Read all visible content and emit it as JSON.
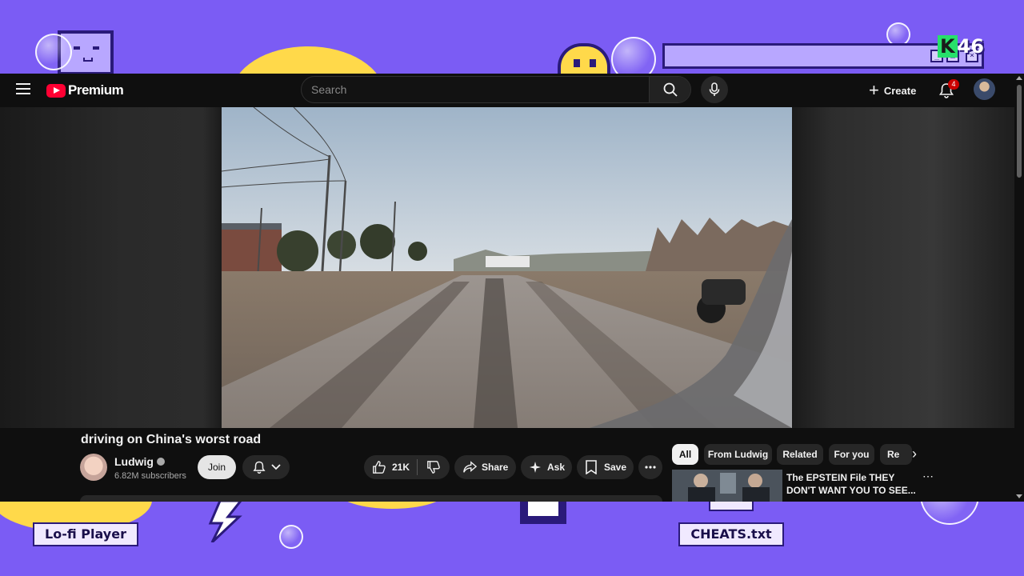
{
  "desktop": {
    "labels": {
      "lofi": "Lo-fi Player",
      "cheats": "CHEATS.txt"
    },
    "badge": {
      "k": "K",
      "num": "46"
    },
    "colors": {
      "background": "#7b5cf4",
      "accent_yellow": "#ffd94a",
      "outline": "#2a1a7a"
    }
  },
  "youtube": {
    "masthead": {
      "logo_text": "Premium",
      "search_placeholder": "Search",
      "create_label": "Create",
      "notification_count": "4",
      "icons": [
        "menu-icon",
        "youtube-logo-icon",
        "search-icon",
        "mic-icon",
        "plus-icon",
        "bell-icon",
        "avatar"
      ]
    },
    "video": {
      "title": "driving on China's worst road"
    },
    "channel": {
      "name": "Ludwig",
      "subscribers": "6.82M subscribers",
      "join_label": "Join"
    },
    "actions": {
      "likes": "21K",
      "share": "Share",
      "ask": "Ask",
      "save": "Save"
    },
    "chips": [
      "All",
      "From Ludwig",
      "Related",
      "For you",
      "Re"
    ],
    "recommendation": {
      "title": "The EPSTEIN File THEY DON'T WANT YOU TO SEE..."
    },
    "colors": {
      "brand_red": "#ff0033",
      "badge_red": "#cc0000",
      "surface": "#0f0f0f",
      "pill": "#272727"
    }
  }
}
